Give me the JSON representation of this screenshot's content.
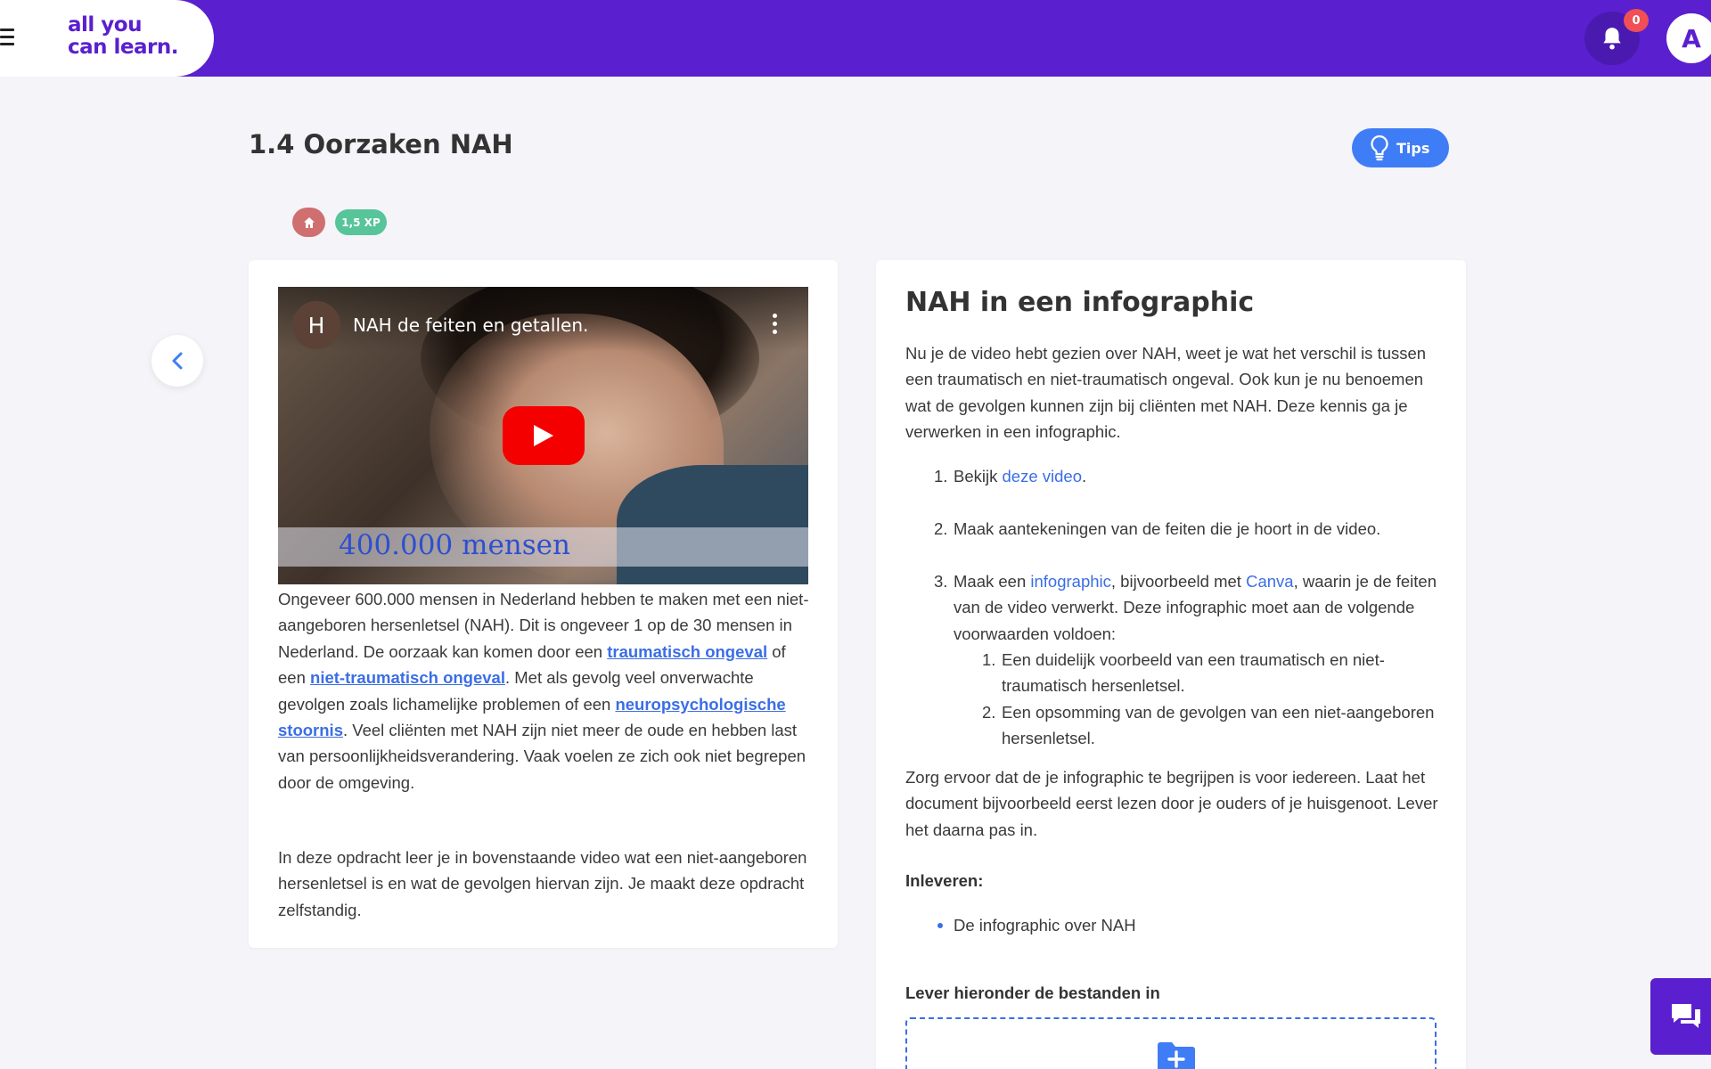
{
  "header": {
    "logo_line1": "all you",
    "logo_line2": "can learn.",
    "notification_count": "0",
    "avatar_initial": "A"
  },
  "page": {
    "title": "1.4 Oorzaken NAH",
    "tips_label": "Tips",
    "xp_label": "1,5 XP"
  },
  "video": {
    "channel_initial": "H",
    "title": "NAH de feiten en getallen.",
    "caption": "400.000 mensen"
  },
  "left_card": {
    "p1_a": "Ongeveer 600.000 mensen in Nederland hebben te maken met een niet-aangeboren hersenletsel (NAH). Dit is ongeveer 1 op de 30 mensen in Nederland. De oorzaak kan komen door een ",
    "link1": "traumatisch ongeval",
    "p1_b": " of een ",
    "link2": "niet-traumatisch ongeval",
    "p1_c": ". Met als gevolg veel onverwachte gevolgen zoals lichamelijke problemen of een ",
    "link3": "neuropsychologische stoornis",
    "p1_d": ". Veel cliënten met NAH zijn niet meer de oude en hebben last van persoonlijkheidsverandering. Vaak voelen ze zich ook niet begrepen door de omgeving.",
    "p2": "In deze opdracht leer je in bovenstaande video wat een niet-aangeboren hersenletsel is en wat de gevolgen hiervan zijn. Je maakt deze opdracht zelfstandig."
  },
  "right_card": {
    "title": "NAH in een infographic",
    "intro": "Nu je de video hebt gezien over NAH, weet je wat het verschil is tussen een traumatisch en niet-traumatisch ongeval. Ook kun je nu benoemen wat de gevolgen kunnen zijn bij cliënten met NAH. Deze kennis ga je verwerken in een infographic.",
    "step1_num": "1.",
    "step1_a": "Bekijk ",
    "step1_link": "deze video",
    "step1_b": ".",
    "step2_num": "2.",
    "step2": "Maak aantekeningen van de feiten die je hoort in de video.",
    "step3_num": "3.",
    "step3_a": "Maak een ",
    "step3_link1": "infographic",
    "step3_b": ", bijvoorbeeld met ",
    "step3_link2": "Canva",
    "step3_c": ", waarin je de feiten van de video verwerkt. Deze infographic moet aan de volgende voorwaarden voldoen:",
    "sub1_num": "1.",
    "sub1": "Een duidelijk voorbeeld van een traumatisch en niet-traumatisch hersenletsel.",
    "sub2_num": "2.",
    "sub2": "Een opsomming van de gevolgen van een niet-aangeboren hersenletsel.",
    "closing": "Zorg ervoor dat de je infographic te begrijpen is voor iedereen. Laat het document bijvoorbeeld eerst lezen door je ouders of je huisgenoot. Lever het daarna pas in.",
    "inleveren_label": "Inleveren:",
    "deliverable": "De infographic over NAH",
    "upload_label": "Lever hieronder de bestanden in"
  },
  "colors": {
    "brand_purple": "#5a1fcf",
    "link_blue": "#3b6ee6",
    "tips_blue": "#3f7df6",
    "badge_red": "#ef4f55",
    "xp_green": "#57c49a",
    "home_chip": "#cf6f6f"
  },
  "icons": [
    "menu-icon",
    "bell-icon",
    "lightbulb-icon",
    "home-icon",
    "chevron-left-icon",
    "play-icon",
    "more-vertical-icon",
    "folder-plus-icon",
    "chat-icon"
  ]
}
